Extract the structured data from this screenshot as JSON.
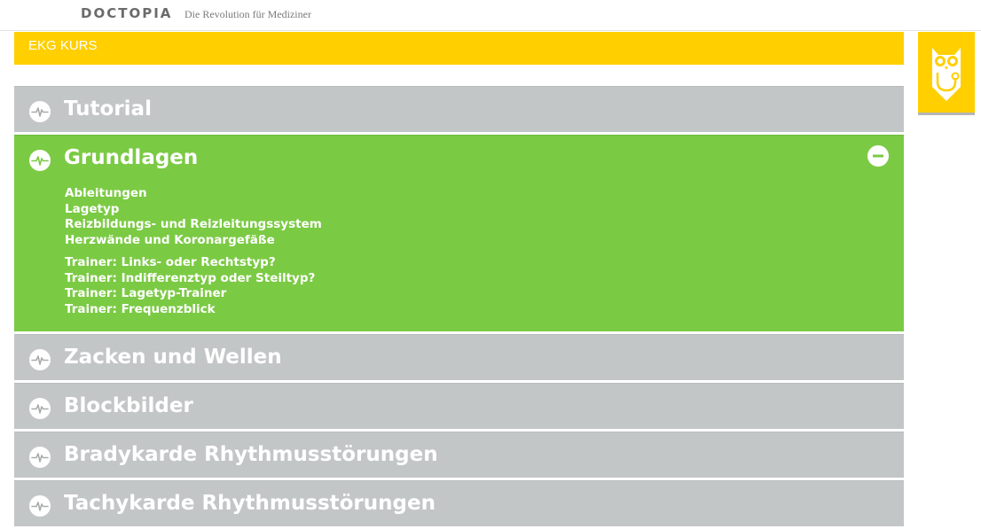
{
  "header": {
    "brand": "DOCTOPIA",
    "tagline": "Die Revolution für Mediziner"
  },
  "course": {
    "title": "EKG KURS"
  },
  "colors": {
    "accent_yellow": "#ffcf00",
    "section_gray": "#c3c6c7",
    "section_active_green": "#7bca44"
  },
  "icons": {
    "section": "ekg-pulse-icon",
    "collapse": "minus-circle-icon",
    "mascot": "owl-stethoscope-icon"
  },
  "sections": [
    {
      "title": "Tutorial",
      "expanded": false
    },
    {
      "title": "Grundlagen",
      "expanded": true,
      "lessons": [
        "Ableitungen",
        "Lagetyp",
        "Reizbildungs- und Reizleitungssystem",
        "Herzwände und Koronargefäße"
      ],
      "trainers": [
        "Trainer: Links- oder Rechtstyp?",
        "Trainer: Indifferenztyp oder Steiltyp?",
        "Trainer: Lagetyp-Trainer",
        "Trainer: Frequenzblick"
      ]
    },
    {
      "title": "Zacken und Wellen",
      "expanded": false
    },
    {
      "title": "Blockbilder",
      "expanded": false
    },
    {
      "title": "Bradykarde Rhythmusstörungen",
      "expanded": false
    },
    {
      "title": "Tachykarde Rhythmusstörungen",
      "expanded": false
    }
  ]
}
